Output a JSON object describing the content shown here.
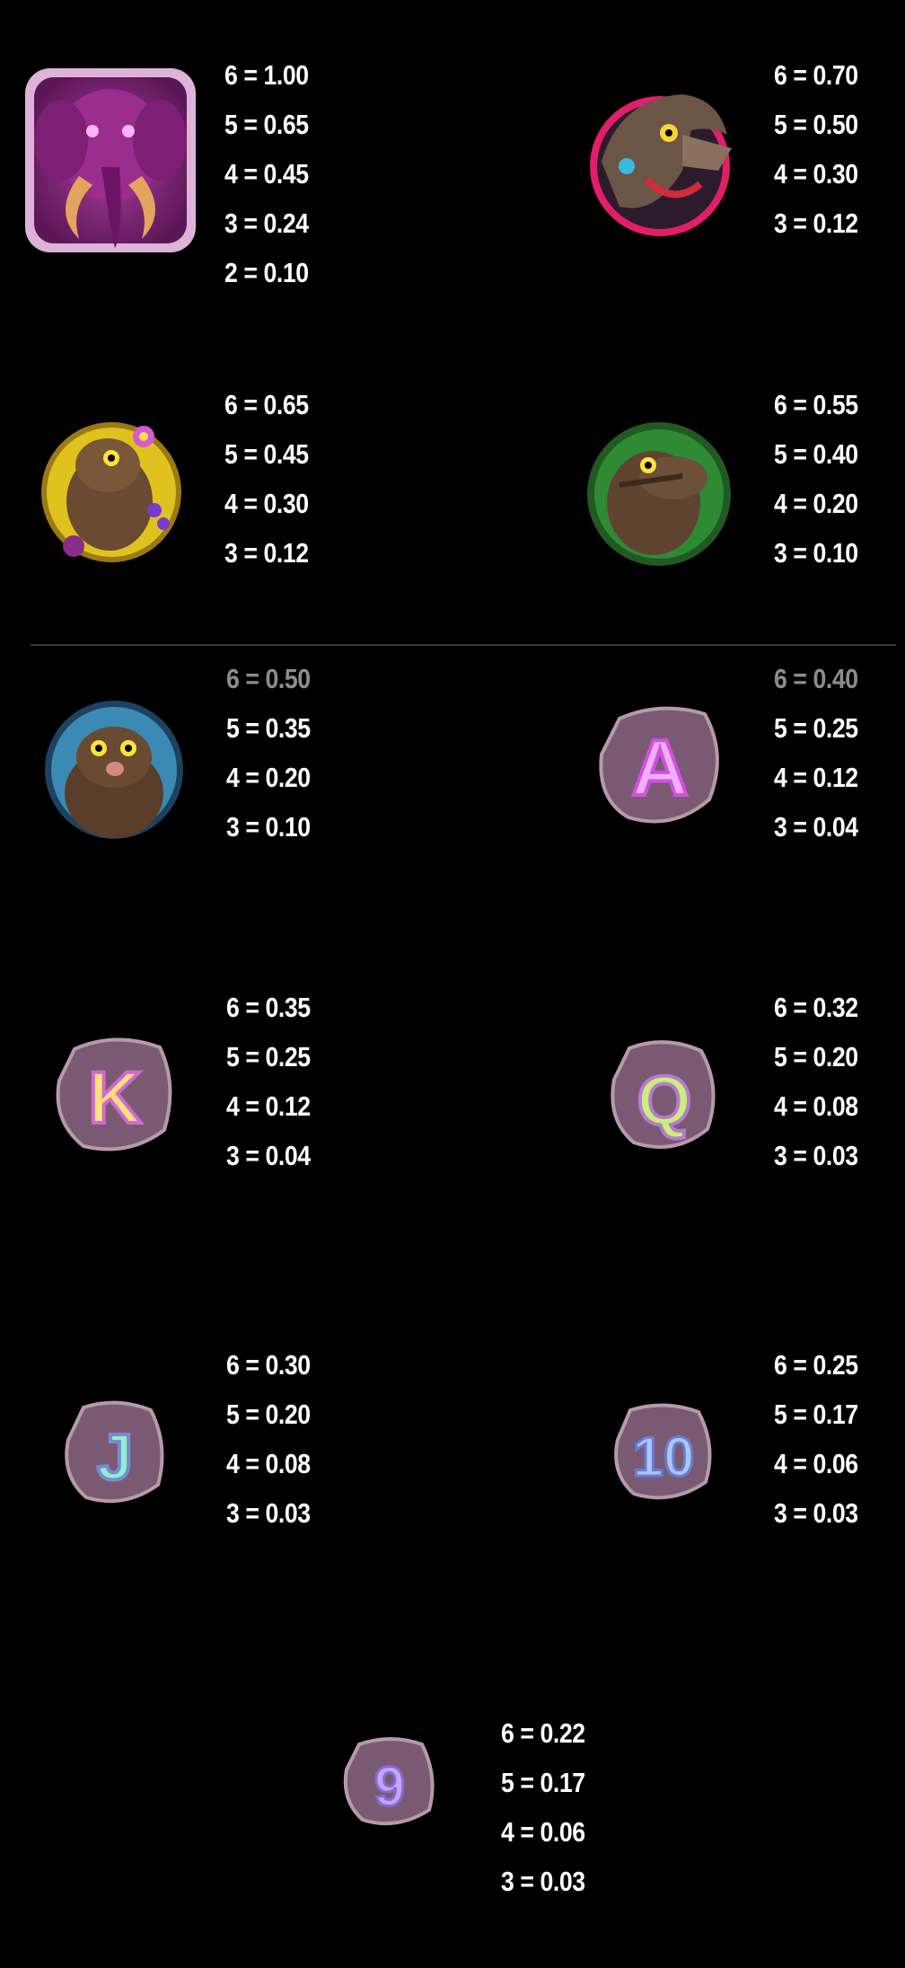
{
  "colors": {
    "background": "#000000",
    "text": "#ffffff",
    "divider": "#3a3a3a"
  },
  "paytable": [
    {
      "symbol": "pink-mammoth",
      "pays": [
        {
          "count": "6",
          "value": "1.00"
        },
        {
          "count": "5",
          "value": "0.65"
        },
        {
          "count": "4",
          "value": "0.45"
        },
        {
          "count": "3",
          "value": "0.24"
        },
        {
          "count": "2",
          "value": "0.10"
        }
      ]
    },
    {
      "symbol": "brown-wolf",
      "pays": [
        {
          "count": "6",
          "value": "0.70"
        },
        {
          "count": "5",
          "value": "0.50"
        },
        {
          "count": "4",
          "value": "0.30"
        },
        {
          "count": "3",
          "value": "0.12"
        }
      ]
    },
    {
      "symbol": "yellow-caveman",
      "pays": [
        {
          "count": "6",
          "value": "0.65"
        },
        {
          "count": "5",
          "value": "0.45"
        },
        {
          "count": "4",
          "value": "0.30"
        },
        {
          "count": "3",
          "value": "0.12"
        }
      ]
    },
    {
      "symbol": "green-caveman",
      "pays": [
        {
          "count": "6",
          "value": "0.55"
        },
        {
          "count": "5",
          "value": "0.40"
        },
        {
          "count": "4",
          "value": "0.20"
        },
        {
          "count": "3",
          "value": "0.10"
        }
      ]
    },
    {
      "symbol": "blue-caveman",
      "pays": [
        {
          "count": "6",
          "value": "0.50"
        },
        {
          "count": "5",
          "value": "0.35"
        },
        {
          "count": "4",
          "value": "0.20"
        },
        {
          "count": "3",
          "value": "0.10"
        }
      ]
    },
    {
      "symbol": "stone-a",
      "letter": "A",
      "pays": [
        {
          "count": "6",
          "value": "0.40"
        },
        {
          "count": "5",
          "value": "0.25"
        },
        {
          "count": "4",
          "value": "0.12"
        },
        {
          "count": "3",
          "value": "0.04"
        }
      ]
    },
    {
      "symbol": "stone-k",
      "letter": "K",
      "pays": [
        {
          "count": "6",
          "value": "0.35"
        },
        {
          "count": "5",
          "value": "0.25"
        },
        {
          "count": "4",
          "value": "0.12"
        },
        {
          "count": "3",
          "value": "0.04"
        }
      ]
    },
    {
      "symbol": "stone-q",
      "letter": "Q",
      "pays": [
        {
          "count": "6",
          "value": "0.32"
        },
        {
          "count": "5",
          "value": "0.20"
        },
        {
          "count": "4",
          "value": "0.08"
        },
        {
          "count": "3",
          "value": "0.03"
        }
      ]
    },
    {
      "symbol": "stone-j",
      "letter": "J",
      "pays": [
        {
          "count": "6",
          "value": "0.30"
        },
        {
          "count": "5",
          "value": "0.20"
        },
        {
          "count": "4",
          "value": "0.08"
        },
        {
          "count": "3",
          "value": "0.03"
        }
      ]
    },
    {
      "symbol": "stone-10",
      "letter": "10",
      "pays": [
        {
          "count": "6",
          "value": "0.25"
        },
        {
          "count": "5",
          "value": "0.17"
        },
        {
          "count": "4",
          "value": "0.06"
        },
        {
          "count": "3",
          "value": "0.03"
        }
      ]
    },
    {
      "symbol": "stone-9",
      "letter": "9",
      "pays": [
        {
          "count": "6",
          "value": "0.22"
        },
        {
          "count": "5",
          "value": "0.17"
        },
        {
          "count": "4",
          "value": "0.06"
        },
        {
          "count": "3",
          "value": "0.03"
        }
      ]
    }
  ]
}
